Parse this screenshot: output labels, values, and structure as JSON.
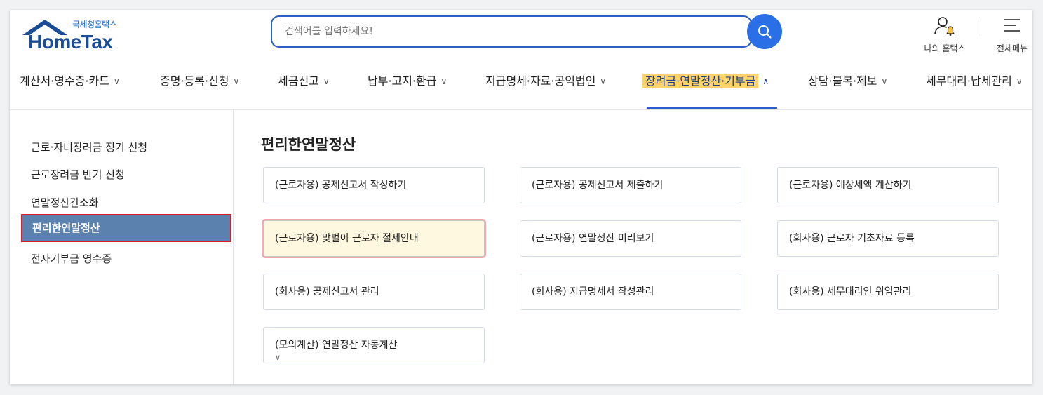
{
  "header": {
    "logo_sub": "국세청홈택스",
    "logo_main": "HomeTax",
    "search_placeholder": "검색어를 입력하세요!",
    "my_hometax_label": "나의 홈택스",
    "all_menu_label": "전체메뉴"
  },
  "nav": {
    "items": [
      {
        "label": "계산서·영수증·카드"
      },
      {
        "label": "증명·등록·신청"
      },
      {
        "label": "세금신고"
      },
      {
        "label": "납부·고지·환급"
      },
      {
        "label": "지급명세·자료·공익법인"
      },
      {
        "label": "장려금·연말정산·기부금",
        "active": true
      },
      {
        "label": "상담·불복·제보"
      },
      {
        "label": "세무대리·납세관리"
      }
    ]
  },
  "sidebar": {
    "items": [
      {
        "label": "근로·자녀장려금 정기 신청"
      },
      {
        "label": "근로장려금 반기 신청"
      },
      {
        "label": "연말정산간소화"
      },
      {
        "label": "편리한연말정산",
        "active": true
      },
      {
        "label": "전자기부금 영수증"
      }
    ]
  },
  "main": {
    "title": "편리한연말정산",
    "cards": [
      {
        "label": "(근로자용) 공제신고서 작성하기"
      },
      {
        "label": "(근로자용) 공제신고서 제출하기"
      },
      {
        "label": "(근로자용) 예상세액 계산하기"
      },
      {
        "label": "(근로자용) 맞벌이 근로자 절세안내",
        "highlight": true
      },
      {
        "label": "(근로자용) 연말정산 미리보기"
      },
      {
        "label": "(회사용) 근로자 기초자료 등록"
      },
      {
        "label": "(회사용) 공제신고서 관리"
      },
      {
        "label": "(회사용) 지급명세서 작성관리"
      },
      {
        "label": "(회사용) 세무대리인 위임관리"
      },
      {
        "label": "(모의계산) 연말정산 자동계산",
        "dropdown": true
      }
    ]
  },
  "colors": {
    "accent": "#2a5fc7",
    "active_nav_bg": "#ffd36a",
    "sidebar_active_bg": "#5b81ae",
    "highlight_border": "#d71d2a"
  }
}
